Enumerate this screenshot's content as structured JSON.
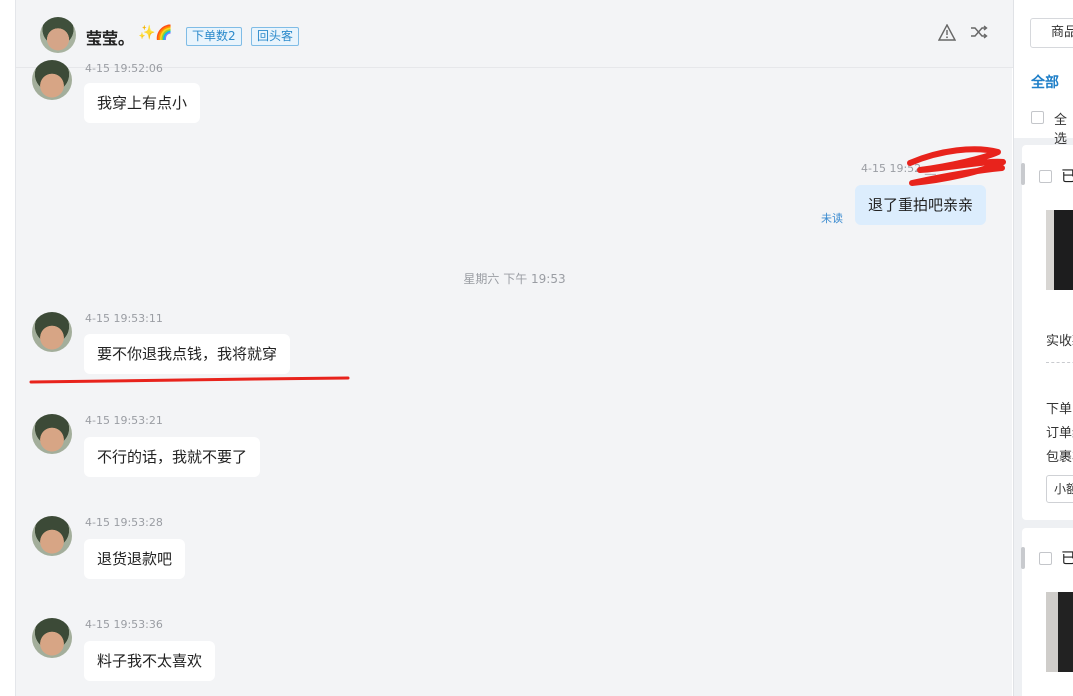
{
  "header": {
    "name": "莹莹。",
    "emoji": "✨🌈",
    "tags": [
      "下单数2",
      "回头客"
    ],
    "icons": [
      "warning-icon",
      "shuffle-icon"
    ]
  },
  "messages": [
    {
      "id": "m0",
      "side": "customer",
      "time": "4-15 19:52:06",
      "text": "我穿上有点小"
    },
    {
      "id": "m1",
      "side": "seller",
      "time": "4-15 19:52:__",
      "text": "退了重拍吧亲亲",
      "status": "未读"
    },
    {
      "id": "sep",
      "type": "day-separator",
      "text": "星期六 下午 19:53"
    },
    {
      "id": "m2",
      "side": "customer",
      "time": "4-15 19:53:11",
      "text": "要不你退我点钱，我将就穿"
    },
    {
      "id": "m3",
      "side": "customer",
      "time": "4-15 19:53:21",
      "text": "不行的话，我就不要了"
    },
    {
      "id": "m4",
      "side": "customer",
      "time": "4-15 19:53:28",
      "text": "退货退款吧"
    },
    {
      "id": "m5",
      "side": "customer",
      "time": "4-15 19:53:36",
      "text": "料子我不太喜欢"
    }
  ],
  "right_panel": {
    "search_label": "商品",
    "tab_all": "全部",
    "select_all": "全选",
    "card1": {
      "status": "已",
      "paid_label": "实收款",
      "fields": [
        "下单时",
        "订单编",
        "包裹状"
      ],
      "button": "小额"
    },
    "card2": {
      "status": "已"
    }
  },
  "annotations": {
    "scribble_color": "#e8231c",
    "underline_color": "#e8231c"
  }
}
